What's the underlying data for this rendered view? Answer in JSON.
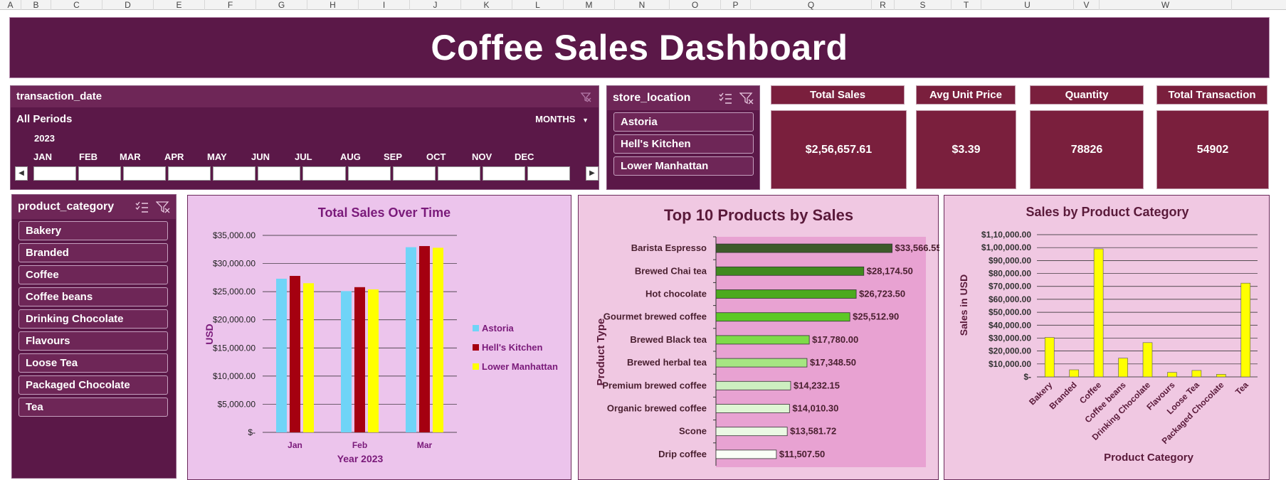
{
  "sheet": {
    "columns": [
      "A",
      "B",
      "C",
      "D",
      "E",
      "F",
      "G",
      "H",
      "I",
      "J",
      "K",
      "L",
      "M",
      "N",
      "O",
      "P",
      "Q",
      "R",
      "S",
      "T",
      "U",
      "V",
      "W"
    ]
  },
  "title": "Coffee Sales Dashboard",
  "timeline": {
    "field": "transaction_date",
    "periods": "All Periods",
    "level": "MONTHS",
    "year": "2023",
    "months": [
      "JAN",
      "FEB",
      "MAR",
      "APR",
      "MAY",
      "JUN",
      "JUL",
      "AUG",
      "SEP",
      "OCT",
      "NOV",
      "DEC"
    ]
  },
  "store_slicer": {
    "field": "store_location",
    "items": [
      "Astoria",
      "Hell's Kitchen",
      "Lower Manhattan"
    ]
  },
  "category_slicer": {
    "field": "product_category",
    "items": [
      "Bakery",
      "Branded",
      "Coffee",
      "Coffee beans",
      "Drinking Chocolate",
      "Flavours",
      "Loose Tea",
      "Packaged Chocolate",
      "Tea"
    ]
  },
  "kpis": [
    {
      "label": "Total Sales",
      "value": "$2,56,657.61"
    },
    {
      "label": "Avg Unit Price",
      "value": "$3.39"
    },
    {
      "label": "Quantity",
      "value": "78826"
    },
    {
      "label": "Total Transaction",
      "value": "54902"
    }
  ],
  "colors": {
    "banner": "#5b1848",
    "kpi": "#7a1f3d",
    "astoria": "#6fd4f7",
    "hells_kitchen": "#a50010",
    "lower_manhattan": "#ffff00",
    "category_bar": "#ffff00"
  },
  "chart_data": [
    {
      "type": "bar",
      "title": "Total Sales Over Time",
      "xlabel": "Year 2023",
      "ylabel": "USD",
      "categories": [
        "Jan",
        "Feb",
        "Mar"
      ],
      "series": [
        {
          "name": "Astoria",
          "values": [
            27300,
            25100,
            32900
          ]
        },
        {
          "name": "Hell's Kitchen",
          "values": [
            27800,
            25800,
            33100
          ]
        },
        {
          "name": "Lower Manhattan",
          "values": [
            26500,
            25400,
            32800
          ]
        }
      ],
      "ylim": [
        0,
        35000
      ],
      "yticks": [
        "$-",
        "$5,000.00",
        "$10,000.00",
        "$15,000.00",
        "$20,000.00",
        "$25,000.00",
        "$30,000.00",
        "$35,000.00"
      ],
      "legend": "right",
      "grid": true
    },
    {
      "type": "bar",
      "orientation": "horizontal",
      "title": "Top 10 Products by Sales",
      "ylabel": "Product Type",
      "categories": [
        "Barista Espresso",
        "Brewed Chai tea",
        "Hot chocolate",
        "Gourmet brewed coffee",
        "Brewed Black tea",
        "Brewed herbal tea",
        "Premium brewed coffee",
        "Organic brewed coffee",
        "Scone",
        "Drip coffee"
      ],
      "values": [
        33566.55,
        28174.5,
        26723.5,
        25512.9,
        17780.0,
        17348.5,
        14232.15,
        14010.3,
        13581.72,
        11507.5
      ],
      "data_labels": [
        "$33,566.55",
        "$28,174.50",
        "$26,723.50",
        "$25,512.90",
        "$17,780.00",
        "$17,348.50",
        "$14,232.15",
        "$14,010.30",
        "$13,581.72",
        "$11,507.50"
      ],
      "bar_colors": [
        "#3d5a2a",
        "#3f8a1e",
        "#4caa1e",
        "#5cc826",
        "#7edb48",
        "#a6e582",
        "#cdeec0",
        "#dff5d4",
        "#ebf9e4",
        "#fafff6"
      ],
      "xlim": [
        0,
        40000
      ],
      "grid": false
    },
    {
      "type": "bar",
      "title": "Sales by Product Category",
      "xlabel": "Product Category",
      "ylabel": "Sales in USD",
      "categories": [
        "Bakery",
        "Branded",
        "Coffee",
        "Coffee beans",
        "Drinking Chocolate",
        "Flavours",
        "Loose Tea",
        "Packaged Chocolate",
        "Tea"
      ],
      "values": [
        30500,
        5500,
        99000,
        14500,
        26500,
        3500,
        5000,
        2000,
        72500
      ],
      "ylim": [
        0,
        110000
      ],
      "yticks": [
        "$-",
        "$10,000.00",
        "$20,000.00",
        "$30,000.00",
        "$40,000.00",
        "$50,000.00",
        "$60,000.00",
        "$70,000.00",
        "$80,000.00",
        "$90,000.00",
        "$1,00,000.00",
        "$1,10,000.00"
      ],
      "grid": true
    }
  ]
}
